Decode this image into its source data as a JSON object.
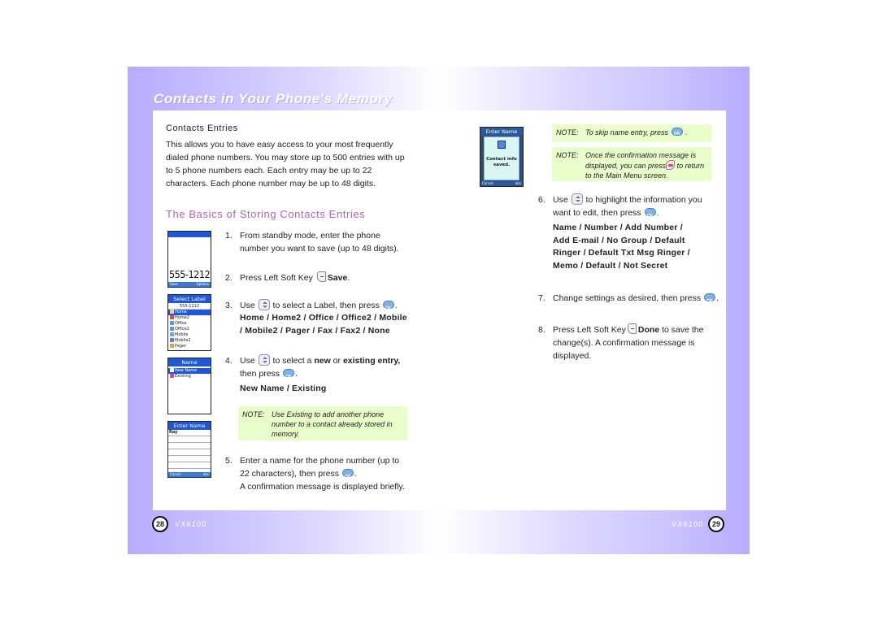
{
  "left_page": {
    "title": "Contacts in Your Phone's Memory",
    "section_heading": "Contacts Entries",
    "intro_lines": [
      "This allows you to have easy access to your most frequently",
      "dialed phone numbers. You may store up to 500 entries with up",
      "to 5 phone numbers each. Each entry may be up to 22",
      "characters. Each phone number may be up to 48 digits."
    ],
    "subheading": "The Basics of Storing Contacts Entries",
    "steps": [
      {
        "num": "1.",
        "lines": [
          "From standby mode, enter the phone",
          "number you want to save (up to 48 digits)."
        ]
      },
      {
        "num": "2.",
        "pre": "Press Left Soft Key",
        "icon": "left-soft-key-icon",
        "bold": "Save",
        "post": "."
      },
      {
        "num": "3.",
        "pre": "Use",
        "icon": "nav-key-icon",
        "mid": "to select a Label, then press",
        "icon2": "ok-key-icon",
        "post": ".",
        "options_lines": [
          "Home / Home2 / Office / Office2 / Mobile",
          "/ Mobile2 / Pager / Fax / Fax2 / None"
        ]
      },
      {
        "num": "4.",
        "pre": "Use",
        "icon": "nav-key-icon",
        "mid": "to select a",
        "bold1": "new",
        "mid2": "or",
        "bold2": "existing entry,",
        "line2_pre": "then press",
        "icon2": "ok-key-icon",
        "post": ".",
        "options": "New Name / Existing"
      },
      {
        "num": "5.",
        "line1": "Enter a name for the phone number (up to",
        "line2_pre": "22 characters), then press",
        "icon2": "ok-key-icon",
        "post": ".",
        "line3": "A confirmation message is displayed briefly."
      }
    ],
    "note": {
      "label": "NOTE:",
      "lines": [
        "Use Existing to add another phone",
        "number to a contact already stored in",
        "memory."
      ]
    },
    "page_number": "28",
    "model": "VX6100",
    "screens": {
      "standby": {
        "number": "555-1212",
        "left_soft": "Save",
        "right_soft": "Options"
      },
      "select_label": {
        "title": "Select Label",
        "number": "555-1212",
        "items": [
          "Home",
          "Home2",
          "Office",
          "Office2",
          "Mobile",
          "Mobile2",
          "Pager"
        ],
        "selected": 0
      },
      "name": {
        "title": "Name",
        "items": [
          "New Name",
          "Existing"
        ],
        "selected": 0
      },
      "enter_name": {
        "title": "Enter Name",
        "value": "Ray",
        "left_soft": "Cancel",
        "right_soft": "abc"
      }
    }
  },
  "right_page": {
    "notes": [
      {
        "label": "NOTE:",
        "pre": "To skip name entry, press",
        "icon": "ok-key-icon",
        "post": "."
      },
      {
        "label": "NOTE:",
        "line1": "Once the confirmation message is",
        "line2_pre": "displayed, you can press",
        "icon": "end-key-icon",
        "line2_post": "to return",
        "line3": "to the Main Menu screen."
      }
    ],
    "steps": [
      {
        "num": "6.",
        "pre": "Use",
        "icon": "nav-key-icon",
        "mid": "to highlight the information you",
        "line2_pre": "want to edit, then press",
        "icon2": "ok-key-icon",
        "post": ".",
        "options_lines": [
          "Name / Number / Add Number /",
          "Add E-mail / No Group / Default",
          "Ringer / Default Txt Msg Ringer /",
          "Memo / Default / Not Secret"
        ]
      },
      {
        "num": "7.",
        "pre": "Change settings as desired, then press",
        "icon2": "ok-key-icon",
        "post": "."
      },
      {
        "num": "8.",
        "pre": "Press Left Soft Key",
        "icon": "left-soft-key-icon",
        "bold": "Done",
        "mid": "to save the",
        "line2": "change(s). A confirmation message is",
        "line3": "displayed."
      }
    ],
    "screen": {
      "title": "Enter Name",
      "message_line1": "Contact info",
      "message_line2": "saved.",
      "left_soft": "Cancel",
      "right_soft": "abc"
    },
    "page_number": "29",
    "model": "VX6100"
  },
  "colors": {
    "band": "#b6abff",
    "note_bg": "#e8fdc9",
    "subheading": "#b066b8",
    "screen_blue": "#1f57d6"
  }
}
